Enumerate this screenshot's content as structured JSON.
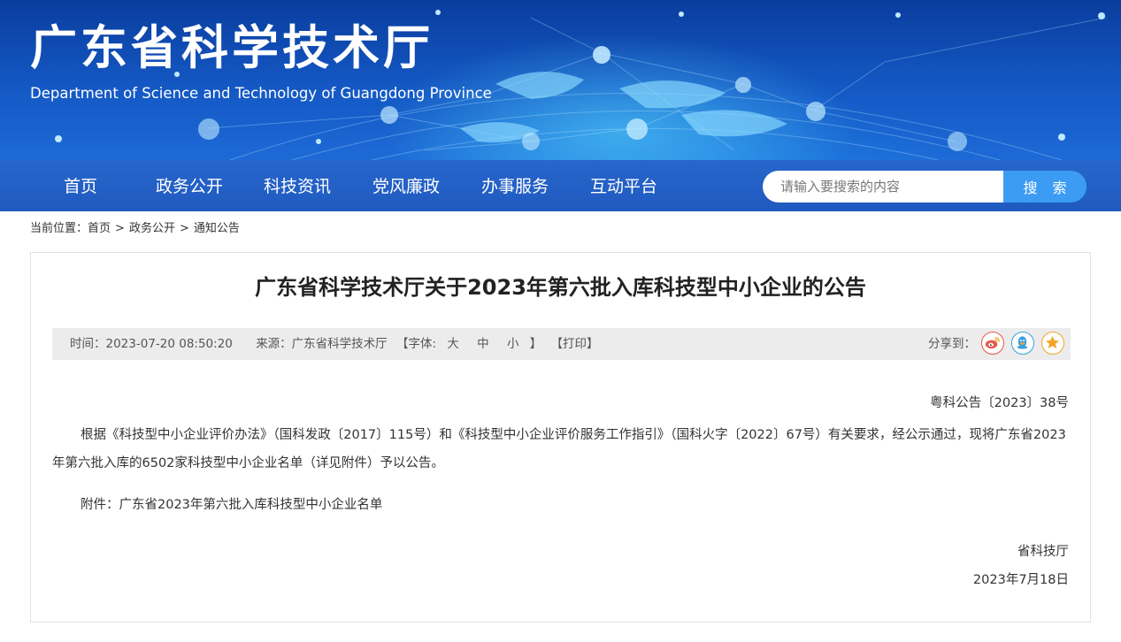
{
  "banner": {
    "title": "广东省科学技术厅",
    "subtitle": "Department of Science and Technology of Guangdong Province"
  },
  "nav": {
    "items": [
      {
        "label": "首页"
      },
      {
        "label": "政务公开"
      },
      {
        "label": "科技资讯"
      },
      {
        "label": "党风廉政"
      },
      {
        "label": "办事服务"
      },
      {
        "label": "互动平台"
      }
    ],
    "search_placeholder": "请输入要搜索的内容",
    "search_button": "搜 索"
  },
  "breadcrumb": {
    "prefix": "当前位置：",
    "items": [
      "首页",
      "政务公开",
      "通知公告"
    ],
    "separator": ">"
  },
  "article": {
    "title": "广东省科学技术厅关于2023年第六批入库科技型中小企业的公告",
    "meta": {
      "time": "时间：2023-07-20 08:50:20",
      "source": "来源：广东省科学技术厅",
      "font_size_label": "【字体:",
      "font_large": "大",
      "font_medium": "中",
      "font_small": "小",
      "font_size_close": "】",
      "print": "【打印】",
      "share_label": "分享到："
    },
    "share_icons": [
      "weibo-icon",
      "qq-icon",
      "favorite-icon"
    ],
    "doc_number": "粤科公告〔2023〕38号",
    "paragraph": "根据《科技型中小企业评价办法》（国科发政〔2017〕115号）和《科技型中小企业评价服务工作指引》（国科火字〔2022〕67号）有关要求，经公示通过，现将广东省2023年第六批入库的6502家科技型中小企业名单（详见附件）予以公告。",
    "attachment": "附件：广东省2023年第六批入库科技型中小企业名单",
    "signature_org": "省科技厅",
    "signature_date": "2023年7月18日"
  },
  "colors": {
    "banner_dark": "#0a3d9e",
    "nav_bar": "#2461c8",
    "search_button": "#3c9cf3",
    "meta_bar": "#ececec"
  }
}
